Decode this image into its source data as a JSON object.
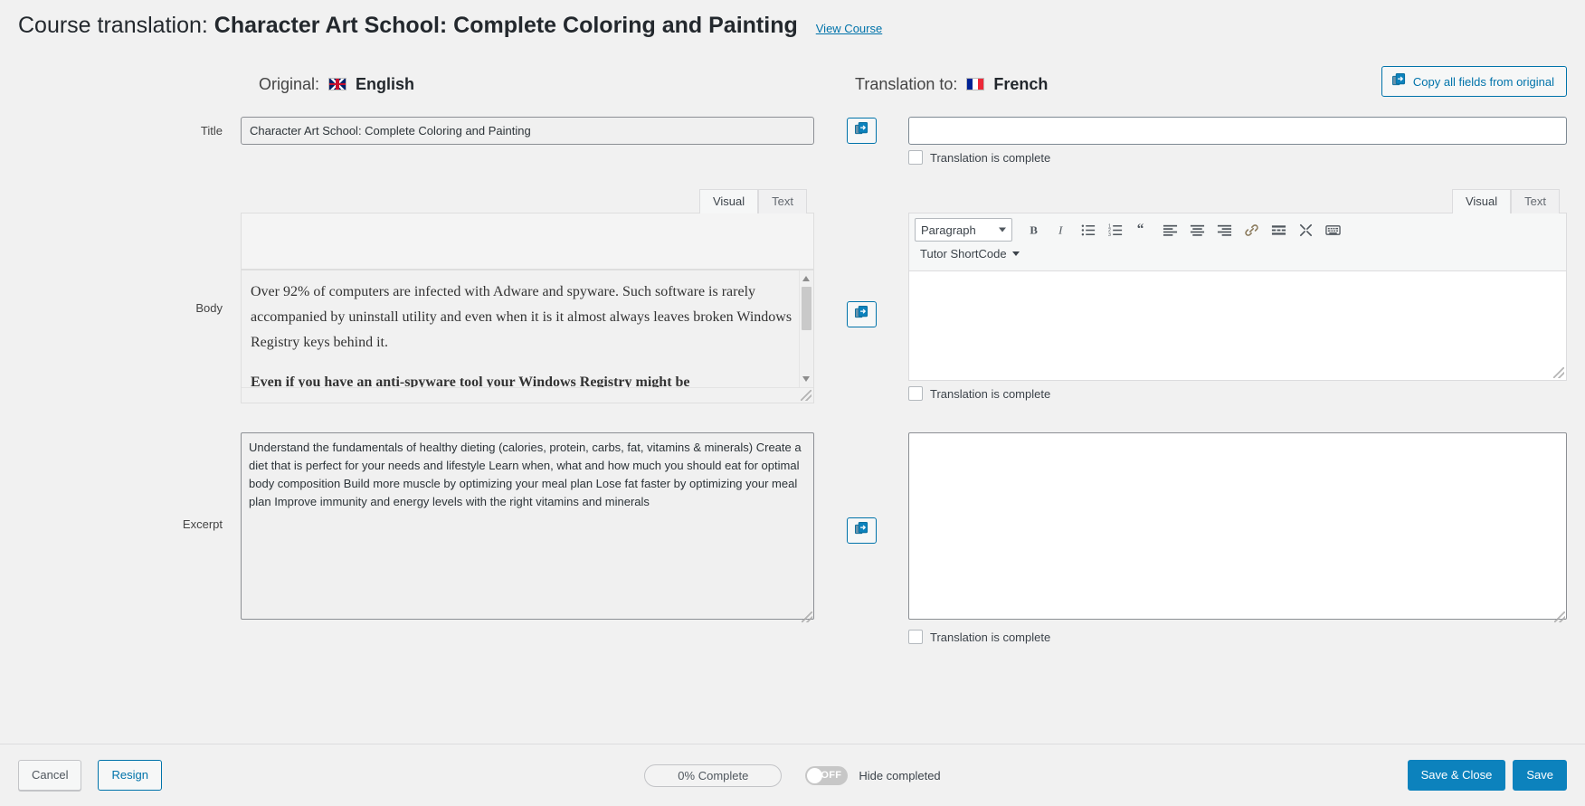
{
  "header": {
    "prefix": "Course translation:",
    "course_title": "Character Art School: Complete Coloring and Painting",
    "view_course_link": "View Course"
  },
  "columns": {
    "original": {
      "label": "Original:",
      "language": "English",
      "flag_icon": "uk-flag-icon"
    },
    "translation": {
      "label": "Translation to:",
      "language": "French",
      "flag_icon": "france-flag-icon"
    },
    "copy_all_button": "Copy all fields from original",
    "copy_all_icon": "copy-icon"
  },
  "fields": {
    "title": {
      "label": "Title",
      "original_value": "Character Art School: Complete Coloring and Painting",
      "translation_value": "",
      "translation_placeholder": "",
      "complete_checkbox_label": "Translation is complete",
      "complete_checked": false,
      "copy_icon": "copy-icon"
    },
    "body": {
      "label": "Body",
      "original_paragraphs": [
        "Over 92% of computers are infected with Adware and spyware. Such software is rarely accompanied by uninstall utility and even when it is it almost always leaves broken Windows Registry keys behind it.",
        "Even if you have an anti-spyware tool your Windows Registry might be"
      ],
      "translation_value": "",
      "complete_checkbox_label": "Translation is complete",
      "complete_checked": false,
      "copy_icon": "copy-icon",
      "tabs": {
        "visual": "Visual",
        "text": "Text",
        "active": "Visual"
      },
      "toolbar": {
        "format_select": "Paragraph",
        "shortcode_button": "Tutor ShortCode",
        "buttons": [
          "bold-icon",
          "italic-icon",
          "bulleted-list-icon",
          "numbered-list-icon",
          "blockquote-icon",
          "align-left-icon",
          "align-center-icon",
          "align-right-icon",
          "link-icon",
          "read-more-icon",
          "fullscreen-icon",
          "toolbar-toggle-icon"
        ]
      }
    },
    "excerpt": {
      "label": "Excerpt",
      "original_value": "Understand the fundamentals of healthy dieting (calories, protein, carbs, fat, vitamins & minerals) Create a diet that is perfect for your needs and lifestyle Learn when, what and how much you should eat for optimal body composition Build more muscle by optimizing your meal plan Lose fat faster by optimizing your meal plan Improve immunity and energy levels with the right vitamins and minerals",
      "translation_value": "",
      "complete_checkbox_label": "Translation is complete",
      "complete_checked": false,
      "copy_icon": "copy-icon"
    }
  },
  "footer": {
    "cancel_button": "Cancel",
    "resign_button": "Resign",
    "progress_text": "0% Complete",
    "progress_percent": 0,
    "toggle_state": "OFF",
    "toggle_label": "Hide completed",
    "save_close_button": "Save & Close",
    "save_button": "Save"
  },
  "colors": {
    "accent": "#0073aa",
    "primary_button": "#0c82bd",
    "page_background": "#f1f1f1",
    "border": "#dcdcde"
  }
}
